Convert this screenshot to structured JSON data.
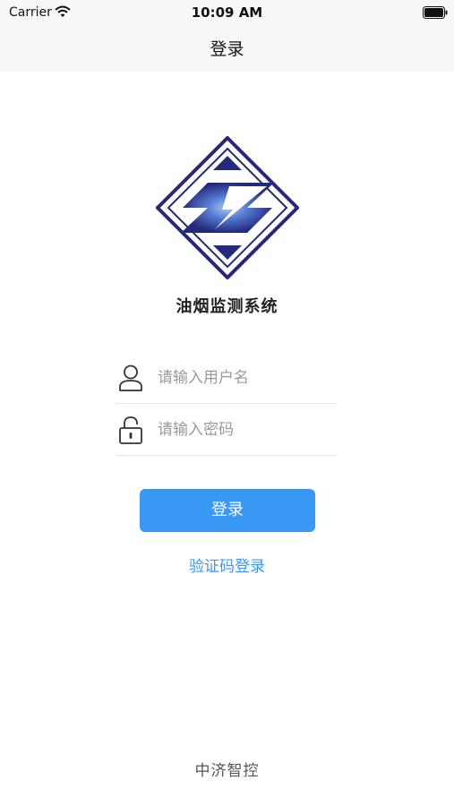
{
  "status_bar": {
    "carrier": "Carrier",
    "time": "10:09 AM"
  },
  "nav": {
    "title": "登录"
  },
  "app": {
    "name": "油烟监测系统"
  },
  "form": {
    "username_placeholder": "请输入用户名",
    "password_placeholder": "请输入密码",
    "login_label": "登录",
    "sms_login_label": "验证码登录"
  },
  "footer": {
    "text": "中济智控"
  },
  "icons": {
    "wifi": "wifi-icon",
    "battery": "battery-icon",
    "logo": "diamond-logo",
    "user": "user-icon",
    "lock": "lock-icon"
  },
  "colors": {
    "accent": "#3a98f5",
    "logo_navy": "#24297a",
    "logo_glow": "#6f9ee6"
  }
}
